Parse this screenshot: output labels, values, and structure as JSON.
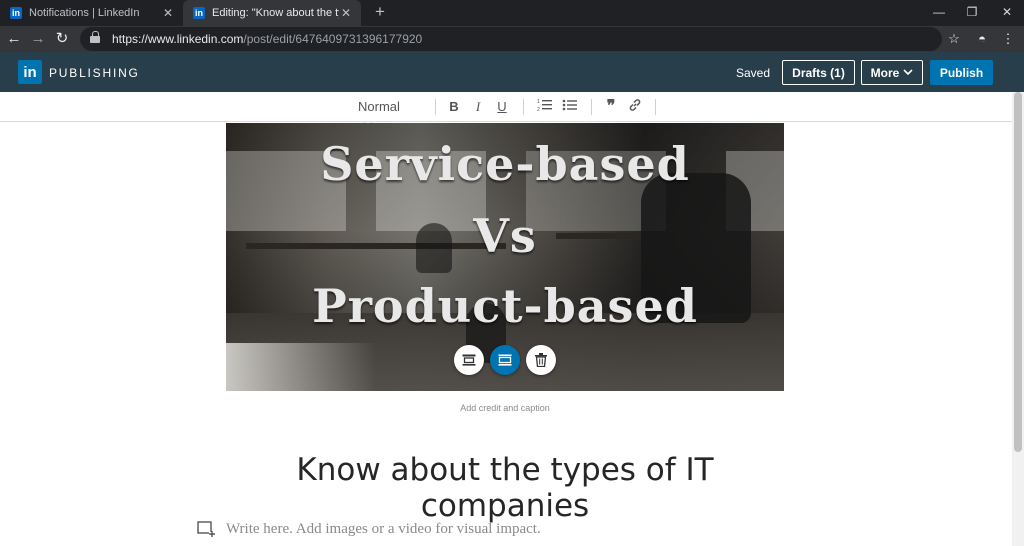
{
  "browser": {
    "tabs": [
      {
        "title": "Notifications | LinkedIn",
        "active": false
      },
      {
        "title": "Editing: \"Know about the types o",
        "active": true
      }
    ],
    "favicon_text": "in",
    "url_host": "https://www.linkedin.com",
    "url_path": "/post/edit/6476409731396177920"
  },
  "publisher": {
    "logo_text": "in",
    "brand": "PUBLISHING",
    "status": "Saved",
    "drafts_label": "Drafts (1)",
    "more_label": "More",
    "publish_label": "Publish"
  },
  "toolbar": {
    "style_select": "Normal",
    "bold": "B",
    "italic": "I",
    "underline": "U"
  },
  "article": {
    "cover_lines": [
      "Service-based",
      "Vs",
      "Product-based"
    ],
    "caption_placeholder": "Add credit and caption",
    "headline": "Know about the types of IT companies",
    "body_placeholder": "Write here. Add images or a video for visual impact."
  },
  "colors": {
    "linkedin_blue": "#0073b1",
    "publish_bar": "#283e4a"
  }
}
